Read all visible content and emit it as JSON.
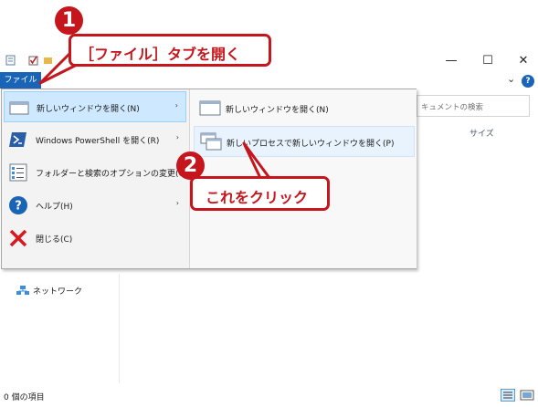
{
  "window": {
    "file_tab_label": "ファイル",
    "search_placeholder": "キュメントの検索",
    "column_size_label": "サイズ",
    "controls": {
      "minimize": "—",
      "maximize": "☐",
      "close": "✕",
      "collapse": "⌄",
      "help": "?"
    }
  },
  "file_menu": {
    "items": [
      {
        "label": "新しいウィンドウを開く(N)",
        "icon": "window-icon",
        "has_submenu": true,
        "selected": true
      },
      {
        "label": "Windows PowerShell を開く(R)",
        "icon": "powershell-icon",
        "has_submenu": true,
        "selected": false
      },
      {
        "label": "フォルダーと検索のオプションの変更(O)",
        "icon": "options-icon",
        "has_submenu": false,
        "selected": false
      },
      {
        "label": "ヘルプ(H)",
        "icon": "help-icon",
        "has_submenu": true,
        "selected": false
      },
      {
        "label": "閉じる(C)",
        "icon": "close-x-icon",
        "has_submenu": false,
        "selected": false
      }
    ],
    "submenu_arrow": "›",
    "submenu": [
      {
        "label": "新しいウィンドウを開く(N)",
        "icon": "window-icon",
        "highlighted": false
      },
      {
        "label": "新しいプロセスで新しいウィンドウを開く(P)",
        "icon": "new-process-window-icon",
        "highlighted": true
      }
    ]
  },
  "nav": {
    "network_label": "ネットワーク"
  },
  "status_bar": {
    "item_count": "0 個の項目"
  },
  "callouts": [
    {
      "number": "1",
      "text": "［ファイル］タブを開く"
    },
    {
      "number": "2",
      "text": "これをクリック"
    }
  ],
  "colors": {
    "accent": "#c4161c",
    "file_tab": "#1a64b8",
    "selected_item": "#cde8ff"
  }
}
